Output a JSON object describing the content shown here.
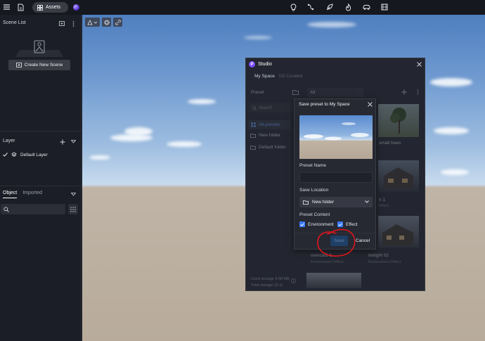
{
  "topbar": {
    "assets_label": "Assets",
    "icons": [
      "menu-icon",
      "file-icon",
      "lightbulb-icon",
      "curve-icon",
      "leaf-icon",
      "flame-icon",
      "car-icon",
      "film-icon"
    ]
  },
  "left_panel": {
    "scene_list_title": "Scene List",
    "create_scene_label": "Create New Scene",
    "layer_title": "Layer",
    "default_layer": "Default Layer",
    "tabs": [
      {
        "label": "Object"
      },
      {
        "label": "Imported"
      }
    ]
  },
  "studio": {
    "title": "Studio",
    "tab_my_space": "My Space",
    "tab_d5_curated": "D5 Curated",
    "preset_label": "Preset",
    "filter_value": "All",
    "search_placeholder": "Search",
    "sidebar_items": [
      "All presets",
      "New folder",
      "Default folder"
    ],
    "thumbs": [
      {
        "label": "small trees",
        "sub": ""
      },
      {
        "label": "n 1",
        "sub": "Effect"
      },
      {
        "label": "twilight 02",
        "sub": "Environment Effect"
      },
      {
        "label": "overcast 1",
        "sub": "Environment Effect"
      }
    ],
    "used_storage": "Used storage 9.58 MB",
    "total_storage": "Total storage 10 G"
  },
  "modal": {
    "title": "Save preset to My Space",
    "preset_name_label": "Preset Name",
    "preset_name_value": "",
    "save_location_label": "Save Location",
    "save_location_value": "New folder",
    "preset_content_label": "Preset Content",
    "environment_label": "Environment",
    "effect_label": "Effect",
    "save_label": "Save",
    "cancel_label": "Cancel"
  },
  "colors": {
    "accent": "#3a7bff",
    "brand": "#7a4dff",
    "annotation": "#e0161b"
  }
}
